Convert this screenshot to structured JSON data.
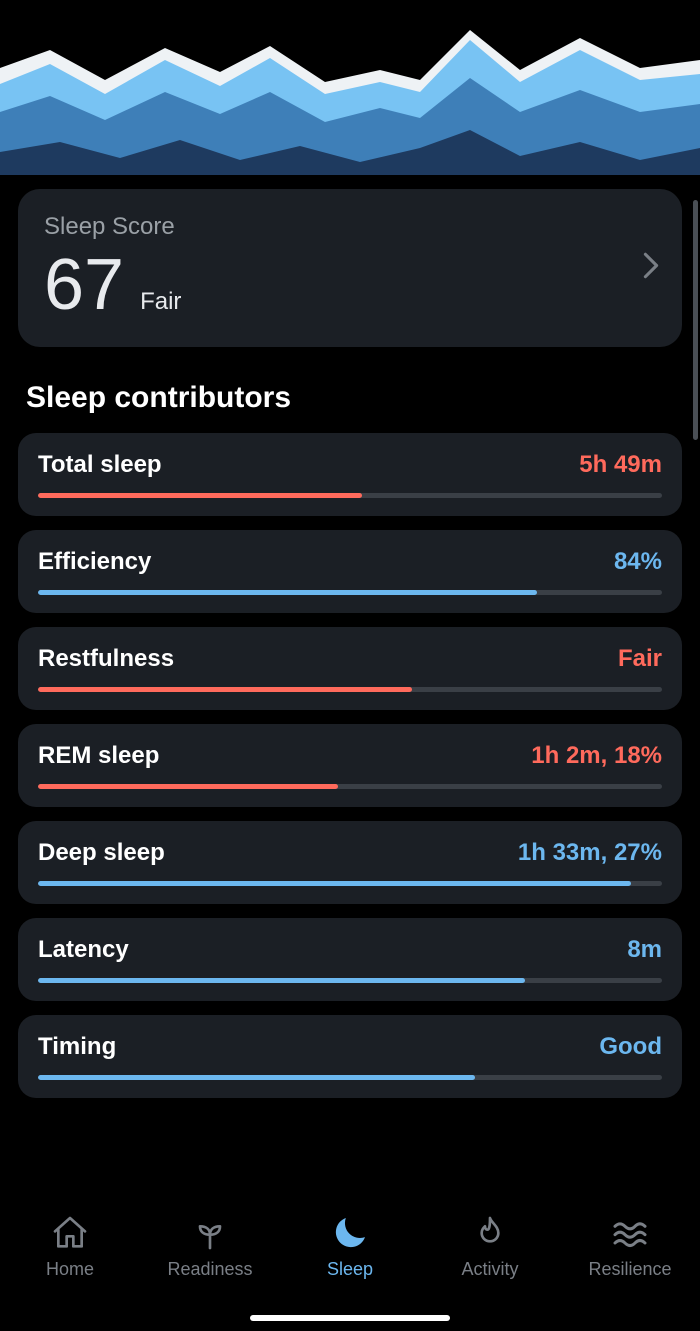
{
  "sleep_score": {
    "title": "Sleep Score",
    "value": "67",
    "qualifier": "Fair"
  },
  "section_title": "Sleep contributors",
  "contributors": [
    {
      "label": "Total sleep",
      "value": "5h 49m",
      "tone": "red",
      "pct": 52
    },
    {
      "label": "Efficiency",
      "value": "84%",
      "tone": "blue",
      "pct": 80
    },
    {
      "label": "Restfulness",
      "value": "Fair",
      "tone": "red",
      "pct": 60
    },
    {
      "label": "REM sleep",
      "value": "1h 2m, 18%",
      "tone": "red",
      "pct": 48
    },
    {
      "label": "Deep sleep",
      "value": "1h 33m, 27%",
      "tone": "blue",
      "pct": 95
    },
    {
      "label": "Latency",
      "value": "8m",
      "tone": "blue",
      "pct": 78
    },
    {
      "label": "Timing",
      "value": "Good",
      "tone": "blue",
      "pct": 70
    }
  ],
  "tabs": [
    {
      "id": "home",
      "label": "Home",
      "active": false
    },
    {
      "id": "readiness",
      "label": "Readiness",
      "active": false
    },
    {
      "id": "sleep",
      "label": "Sleep",
      "active": true
    },
    {
      "id": "activity",
      "label": "Activity",
      "active": false
    },
    {
      "id": "resilience",
      "label": "Resilience",
      "active": false
    }
  ],
  "colors": {
    "red": "#ff6a5c",
    "blue": "#6cb7ef",
    "card": "#1b1f25",
    "muted": "#9aa0a6"
  },
  "chart_data": {
    "type": "area",
    "note": "Stacked sleep-stage area chart (decorative, no axes/labels visible)",
    "series": [
      {
        "name": "layer-white",
        "color": "#eef2f5"
      },
      {
        "name": "layer-lightblue",
        "color": "#78c3f3"
      },
      {
        "name": "layer-midblue",
        "color": "#3e7fb8"
      },
      {
        "name": "layer-darkblue",
        "color": "#1e3a5f"
      }
    ]
  }
}
